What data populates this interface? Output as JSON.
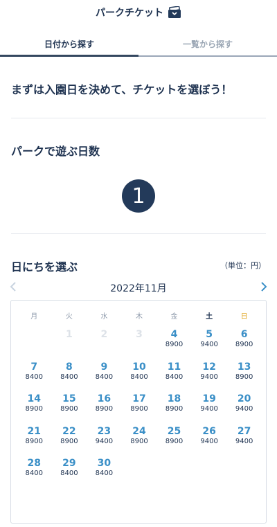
{
  "header": {
    "title": "パークチケット"
  },
  "tabs": [
    {
      "label": "日付から探す",
      "active": true
    },
    {
      "label": "一覧から探す",
      "active": false
    }
  ],
  "lead": "まずは入園日を決めて、チケットを選ぼう！",
  "days": {
    "title": "パークで遊ぶ日数",
    "value": "1"
  },
  "picker": {
    "title": "日にちを選ぶ",
    "unit": "（単位：円）",
    "month_label": "2022年11月",
    "weekdays": [
      "月",
      "火",
      "水",
      "木",
      "金",
      "土",
      "日"
    ],
    "weeks": [
      [
        {
          "day": "",
          "price": ""
        },
        {
          "day": "1",
          "price": "",
          "disabled": true
        },
        {
          "day": "2",
          "price": "",
          "disabled": true
        },
        {
          "day": "3",
          "price": "",
          "disabled": true
        },
        {
          "day": "4",
          "price": "8900"
        },
        {
          "day": "5",
          "price": "9400"
        },
        {
          "day": "6",
          "price": "8900"
        }
      ],
      [
        {
          "day": "7",
          "price": "8400"
        },
        {
          "day": "8",
          "price": "8400"
        },
        {
          "day": "9",
          "price": "8400"
        },
        {
          "day": "10",
          "price": "8400"
        },
        {
          "day": "11",
          "price": "8400"
        },
        {
          "day": "12",
          "price": "9400"
        },
        {
          "day": "13",
          "price": "8900"
        }
      ],
      [
        {
          "day": "14",
          "price": "8900"
        },
        {
          "day": "15",
          "price": "8900"
        },
        {
          "day": "16",
          "price": "8900"
        },
        {
          "day": "17",
          "price": "8900"
        },
        {
          "day": "18",
          "price": "8900"
        },
        {
          "day": "19",
          "price": "9400"
        },
        {
          "day": "20",
          "price": "9400"
        }
      ],
      [
        {
          "day": "21",
          "price": "8900"
        },
        {
          "day": "22",
          "price": "8900"
        },
        {
          "day": "23",
          "price": "9400"
        },
        {
          "day": "24",
          "price": "8900"
        },
        {
          "day": "25",
          "price": "8900"
        },
        {
          "day": "26",
          "price": "9400"
        },
        {
          "day": "27",
          "price": "9400"
        }
      ],
      [
        {
          "day": "28",
          "price": "8400"
        },
        {
          "day": "29",
          "price": "8400"
        },
        {
          "day": "30",
          "price": "8400"
        },
        {
          "day": "",
          "price": ""
        },
        {
          "day": "",
          "price": ""
        },
        {
          "day": "",
          "price": ""
        },
        {
          "day": "",
          "price": ""
        }
      ]
    ]
  },
  "colors": {
    "primary_text": "#1e3250",
    "date_blue": "#3a8fc7",
    "sunday": "#e0a520",
    "circle": "#233a5a"
  }
}
